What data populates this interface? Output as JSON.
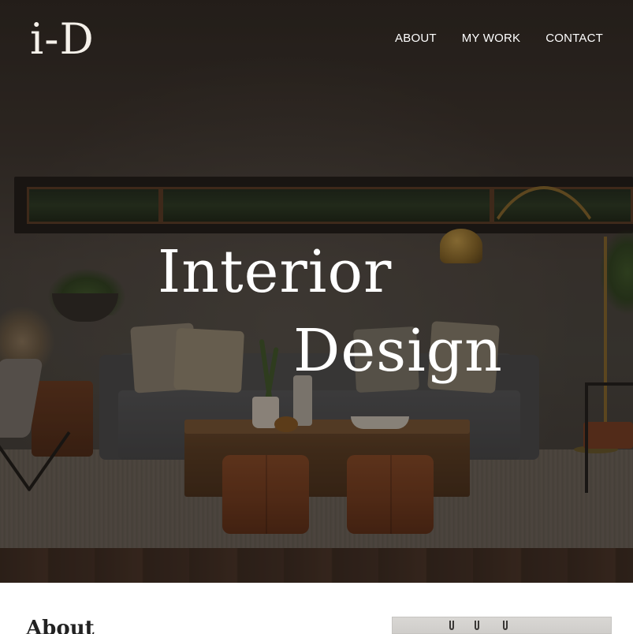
{
  "header": {
    "logo": "i-D",
    "nav": [
      {
        "label": "ABOUT"
      },
      {
        "label": "MY WORK"
      },
      {
        "label": "CONTACT"
      }
    ]
  },
  "hero": {
    "title_line1": "Interior",
    "title_line2": "Design"
  },
  "about": {
    "heading": "About"
  },
  "colors": {
    "text_on_hero": "#ffffff",
    "heading_dark": "#222222",
    "background": "#ffffff"
  }
}
